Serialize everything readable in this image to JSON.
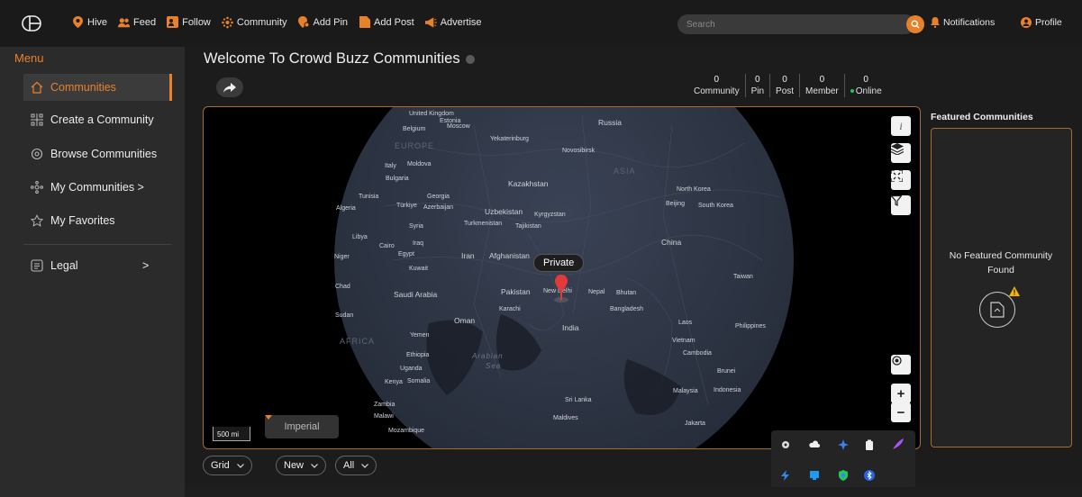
{
  "nav": {
    "items": [
      {
        "label": "Hive",
        "icon": "map-pin-icon"
      },
      {
        "label": "Feed",
        "icon": "users-icon"
      },
      {
        "label": "Follow",
        "icon": "follow-icon"
      },
      {
        "label": "Community",
        "icon": "community-icon"
      },
      {
        "label": "Add Pin",
        "icon": "add-pin-icon"
      },
      {
        "label": "Add Post",
        "icon": "add-post-icon"
      },
      {
        "label": "Advertise",
        "icon": "megaphone-icon"
      }
    ],
    "search_placeholder": "Search",
    "notifications": "Notifications",
    "profile": "Profile"
  },
  "sidebar": {
    "title": "Menu",
    "items": [
      {
        "label": "Communities"
      },
      {
        "label": "Create a Community"
      },
      {
        "label": "Browse Communities"
      },
      {
        "label": "My Communities >"
      },
      {
        "label": "My Favorites"
      },
      {
        "label": "Legal"
      }
    ],
    "legal_arrow": ">"
  },
  "main": {
    "title": "Welcome To Crowd Buzz Communities",
    "stats": [
      {
        "value": "0",
        "label": "Community"
      },
      {
        "value": "0",
        "label": "Pin"
      },
      {
        "value": "0",
        "label": "Post"
      },
      {
        "value": "0",
        "label": "Member"
      },
      {
        "value": "0",
        "label": "Online"
      }
    ]
  },
  "map": {
    "pin_label": "Private",
    "scale": "500 mi",
    "unit": "Imperial",
    "labels": [
      {
        "t": "United Kingdom",
        "c": ""
      },
      {
        "t": "Estonia",
        "c": ""
      },
      {
        "t": "Russia",
        "c": "big"
      },
      {
        "t": "Belgium",
        "c": ""
      },
      {
        "t": "Moscow",
        "c": ""
      },
      {
        "t": "Yekaterinburg",
        "c": ""
      },
      {
        "t": "EUROPE",
        "c": "region"
      },
      {
        "t": "Novosibirsk",
        "c": ""
      },
      {
        "t": "Italy",
        "c": ""
      },
      {
        "t": "Moldova",
        "c": ""
      },
      {
        "t": "ASIA",
        "c": "region"
      },
      {
        "t": "Bulgaria",
        "c": ""
      },
      {
        "t": "Kazakhstan",
        "c": "big"
      },
      {
        "t": "North Korea",
        "c": ""
      },
      {
        "t": "Tunisia",
        "c": ""
      },
      {
        "t": "Georgia",
        "c": ""
      },
      {
        "t": "Beijing",
        "c": ""
      },
      {
        "t": "South Korea",
        "c": ""
      },
      {
        "t": "Algeria",
        "c": ""
      },
      {
        "t": "Türkiye",
        "c": ""
      },
      {
        "t": "Azerbaijan",
        "c": ""
      },
      {
        "t": "Uzbekistan",
        "c": "big"
      },
      {
        "t": "Kyrgyzstan",
        "c": ""
      },
      {
        "t": "Turkmenistan",
        "c": ""
      },
      {
        "t": "Tajikistan",
        "c": ""
      },
      {
        "t": "Syria",
        "c": ""
      },
      {
        "t": "Libya",
        "c": ""
      },
      {
        "t": "Cairo",
        "c": ""
      },
      {
        "t": "Iraq",
        "c": ""
      },
      {
        "t": "China",
        "c": "big"
      },
      {
        "t": "Niger",
        "c": ""
      },
      {
        "t": "Egypt",
        "c": ""
      },
      {
        "t": "Iran",
        "c": "big"
      },
      {
        "t": "Afghanistan",
        "c": "big"
      },
      {
        "t": "Kuwait",
        "c": ""
      },
      {
        "t": "Taiwan",
        "c": ""
      },
      {
        "t": "Chad",
        "c": ""
      },
      {
        "t": "Saudi Arabia",
        "c": "big"
      },
      {
        "t": "Pakistan",
        "c": "big"
      },
      {
        "t": "New Delhi",
        "c": ""
      },
      {
        "t": "Nepal",
        "c": ""
      },
      {
        "t": "Bhutan",
        "c": ""
      },
      {
        "t": "Karachi",
        "c": ""
      },
      {
        "t": "Bangladesh",
        "c": ""
      },
      {
        "t": "Sudan",
        "c": ""
      },
      {
        "t": "Oman",
        "c": "big"
      },
      {
        "t": "India",
        "c": "big"
      },
      {
        "t": "Laos",
        "c": ""
      },
      {
        "t": "Philippines",
        "c": ""
      },
      {
        "t": "AFRICA",
        "c": "region"
      },
      {
        "t": "Yemen",
        "c": ""
      },
      {
        "t": "Vietnam",
        "c": ""
      },
      {
        "t": "Ethiopia",
        "c": ""
      },
      {
        "t": "Arabian",
        "c": "sea"
      },
      {
        "t": "Cambodia",
        "c": ""
      },
      {
        "t": "Sea",
        "c": "sea"
      },
      {
        "t": "Uganda",
        "c": ""
      },
      {
        "t": "Brunei",
        "c": ""
      },
      {
        "t": "Kenya",
        "c": ""
      },
      {
        "t": "Somalia",
        "c": ""
      },
      {
        "t": "Malaysia",
        "c": ""
      },
      {
        "t": "Indonesia",
        "c": ""
      },
      {
        "t": "Sri Lanka",
        "c": ""
      },
      {
        "t": "Zambia",
        "c": ""
      },
      {
        "t": "Malawi",
        "c": ""
      },
      {
        "t": "Maldives",
        "c": ""
      },
      {
        "t": "Jakarta",
        "c": ""
      },
      {
        "t": "Mozambique",
        "c": ""
      }
    ]
  },
  "filters": [
    {
      "label": "Grid"
    },
    {
      "label": "New"
    },
    {
      "label": "All"
    }
  ],
  "featured": {
    "title": "Featured Communities",
    "empty": "No Featured Community Found"
  },
  "colors": {
    "accent": "#e8822a",
    "online": "#22c55e",
    "border": "#a76b2b"
  }
}
